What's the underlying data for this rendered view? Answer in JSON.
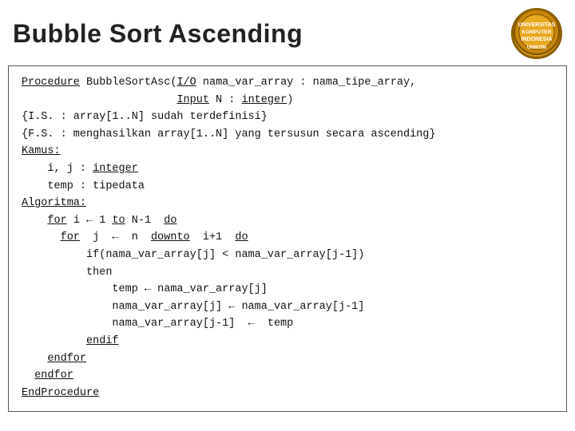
{
  "header": {
    "title": "Bubble Sort Ascending"
  },
  "logo": {
    "text": "UNIKOM"
  },
  "code": {
    "lines": [
      {
        "id": "line1",
        "html": "<u>Procedure</u> BubbleSortAsc(<u>I/O</u> nama_var_array : nama_tipe_array,"
      },
      {
        "id": "line2",
        "html": "                        <u>Input</u> N : <u>integer</u>)"
      },
      {
        "id": "line3",
        "html": "{I.S. : array[1..N] sudah terdefinisi}"
      },
      {
        "id": "line4",
        "html": "{F.S. : menghasilkan array[1..N] yang tersusun secara ascending}"
      },
      {
        "id": "line5",
        "html": "<u>Kamus:</u>"
      },
      {
        "id": "line6",
        "html": "    i, j : <u>integer</u>"
      },
      {
        "id": "line7",
        "html": "    temp : tipedata"
      },
      {
        "id": "line8",
        "html": "<u>Algoritma:</u>"
      },
      {
        "id": "line9",
        "html": "    <u>for</u> i &#8592; 1 <u>to</u> N-1  <u>do</u>"
      },
      {
        "id": "line10",
        "html": "      <u>for</u>  j  &#8592;  n  <u>downto</u>  i+1  <u>do</u>"
      },
      {
        "id": "line11",
        "html": "          if(nama_var_array[j] &lt; nama_var_array[j-1])"
      },
      {
        "id": "line12",
        "html": "          then"
      },
      {
        "id": "line13",
        "html": "              temp &#8592; nama_var_array[j]"
      },
      {
        "id": "line14",
        "html": "              nama_var_array[j] &#8592; nama_var_array[j-1]"
      },
      {
        "id": "line15",
        "html": "              nama_var_array[j-1]  &#8592;  temp"
      },
      {
        "id": "line16",
        "html": "          <u>endif</u>"
      },
      {
        "id": "line17",
        "html": "    <u>endfor</u>"
      },
      {
        "id": "line18",
        "html": "  <u>endfor</u>"
      },
      {
        "id": "line19",
        "html": "<u>EndProcedure</u>"
      }
    ]
  }
}
